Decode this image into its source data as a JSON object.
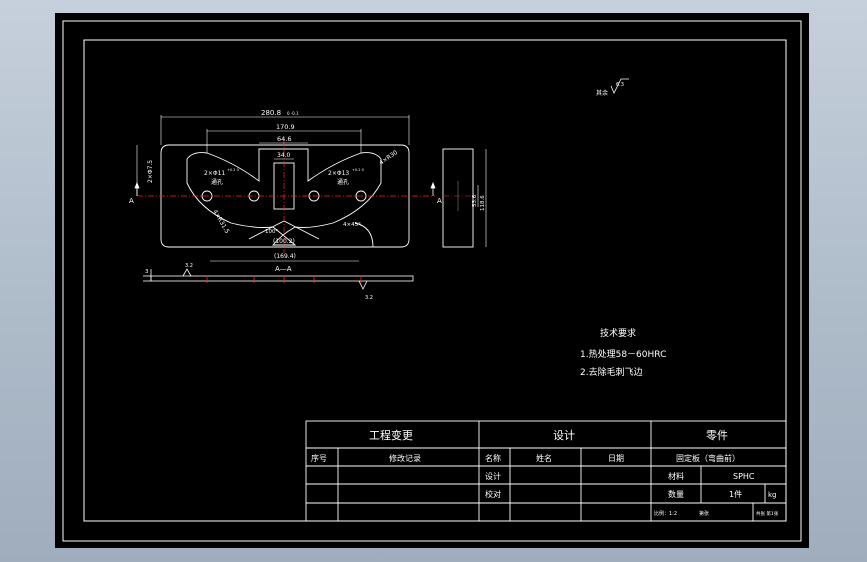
{
  "colors": {
    "line": "#ffffff",
    "hidden": "#7f7f7f",
    "center": "#ff2020",
    "background": "#000000",
    "window": "#aebbc9"
  },
  "roughness": {
    "general_label": "其余",
    "general_value": "6.3",
    "top_value": "3.2",
    "bottom_value": "3.2"
  },
  "plan": {
    "overall_dim": "280.8",
    "overall_tol": "0 -0.1",
    "dim_170": "170.9",
    "dim_64": "64.6",
    "dim_34": "34.0",
    "dim_y_left": "2×Φ7.5",
    "hole_left": "2×Φ11",
    "hole_left_tol": "+0.2 0",
    "hole_left_note": "通孔",
    "hole_right": "2×Φ13",
    "hole_right_tol": "+0.2 0",
    "hole_right_note": "通孔",
    "r_left": "4×R31.5",
    "r_right": "4×R30",
    "angle_bottom": "100°",
    "chamfer_note": "4×45°",
    "dim_100": "(100.2)",
    "dim_169": "(169.4)",
    "section_mark": "A"
  },
  "side": {
    "dim_53": "53.6",
    "dim_118": "118.6"
  },
  "section": {
    "title": "A—A",
    "thickness": "3"
  },
  "tech": {
    "title": "技术要求",
    "items": [
      "1.热处理58－60HRC",
      "2.去除毛刺飞边"
    ]
  },
  "title_block": {
    "eng_change": "工程变更",
    "design": "设计",
    "part": "零件",
    "seq_no": "序号",
    "revision": "修改记录",
    "name_label": "名称",
    "name_value": "姓名",
    "date": "日期",
    "part_name": "固定板（弯曲前）",
    "design_row": "设计",
    "check_row": "校对",
    "material_label": "材料",
    "material_value": "SPHC",
    "qty_label": "数量",
    "qty_value": "1件",
    "weight": "kg",
    "scale": "比例：1:2",
    "sheet": "第张",
    "total": "共张 第1张"
  }
}
